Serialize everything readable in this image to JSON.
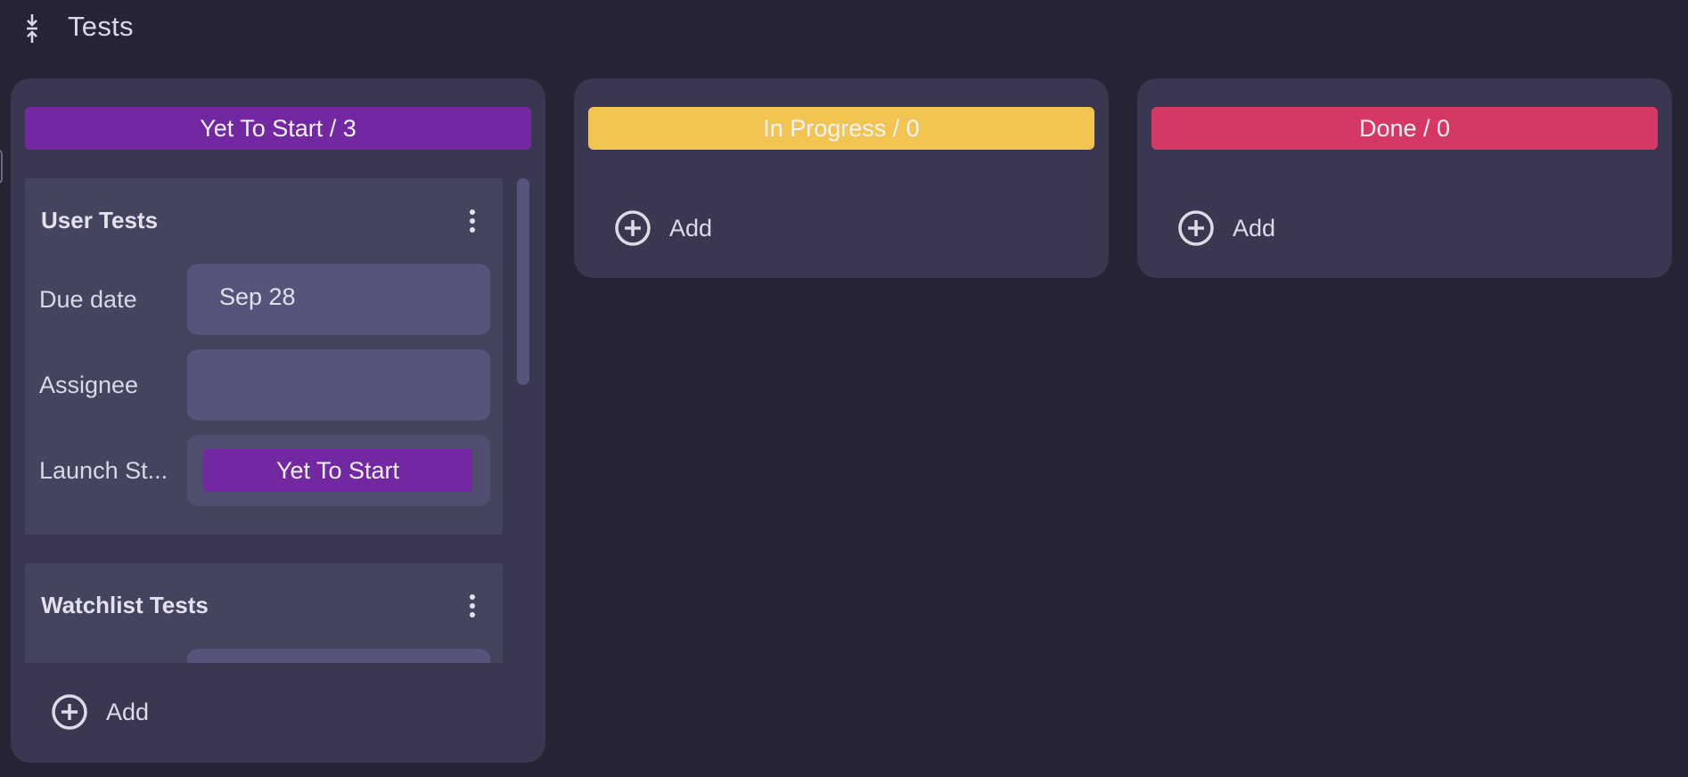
{
  "page": {
    "title": "Tests",
    "collapse_icon": "collapse-vertical-icon"
  },
  "colors": {
    "background": "#262536",
    "column": "#393850",
    "card": "#45445e",
    "field": "#55547a",
    "yet_to_start": "#7228a0",
    "in_progress": "#f2c452",
    "done": "#d53963"
  },
  "columns": [
    {
      "header": "Yet To Start / 3",
      "color": "#7228a0",
      "add_label": "Add",
      "cards": [
        {
          "title": "User Tests",
          "menu_icon": "more-vertical-icon",
          "fields": [
            {
              "label": "Due date",
              "value": "Sep 28"
            },
            {
              "label": "Assignee",
              "value": ""
            },
            {
              "label": "Launch St...",
              "value": "Yet To Start"
            }
          ]
        },
        {
          "title": "Watchlist Tests",
          "menu_icon": "more-vertical-icon"
        }
      ]
    },
    {
      "header": "In Progress / 0",
      "color": "#f2c452",
      "add_label": "Add"
    },
    {
      "header": "Done / 0",
      "color": "#d53963",
      "add_label": "Add"
    }
  ]
}
